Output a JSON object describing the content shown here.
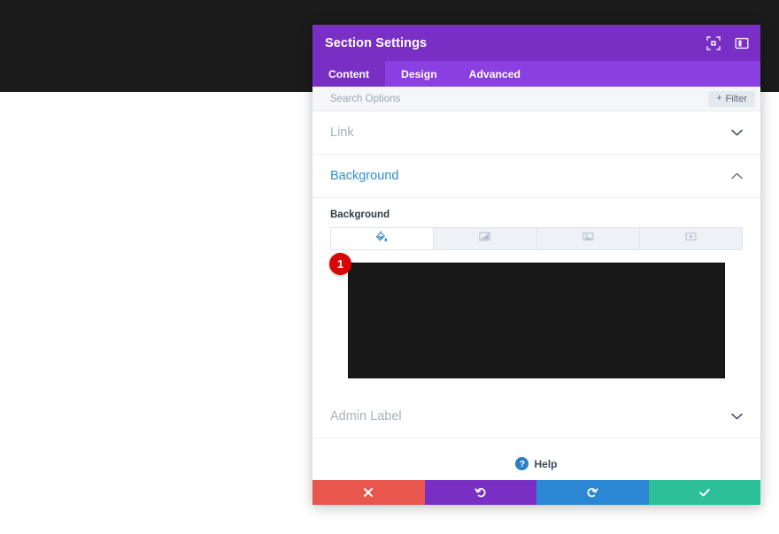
{
  "panel": {
    "title": "Section Settings",
    "header_icons": [
      {
        "name": "focus-target-icon",
        "label": "Focus"
      },
      {
        "name": "panel-layout-icon",
        "label": "Layout"
      }
    ],
    "tabs": [
      {
        "label": "Content",
        "active": true
      },
      {
        "label": "Design",
        "active": false
      },
      {
        "label": "Advanced",
        "active": false
      }
    ],
    "search": {
      "placeholder": "Search Options",
      "value": "",
      "filter_label": "Filter",
      "filter_plus": "+"
    },
    "sections": [
      {
        "label": "Link",
        "state": "collapsed",
        "chevron": "down"
      },
      {
        "label": "Background",
        "state": "expanded",
        "chevron": "up"
      },
      {
        "label": "Admin Label",
        "state": "collapsed",
        "chevron": "down"
      }
    ],
    "background": {
      "field_label": "Background",
      "types": [
        {
          "name": "background-color-tab",
          "icon": "paint-bucket-icon",
          "active": true
        },
        {
          "name": "background-gradient-tab",
          "icon": "gradient-icon",
          "active": false
        },
        {
          "name": "background-image-tab",
          "icon": "image-icon",
          "active": false
        },
        {
          "name": "background-video-tab",
          "icon": "video-icon",
          "active": false
        }
      ],
      "selected_color": "#181818",
      "step_badge": "1"
    },
    "help": {
      "glyph": "?",
      "label": "Help"
    },
    "footer": [
      {
        "name": "cancel-button",
        "icon": "close-x-icon",
        "color": "#e9564e"
      },
      {
        "name": "undo-button",
        "icon": "undo-arrow-icon",
        "color": "#7a2fc4"
      },
      {
        "name": "redo-button",
        "icon": "redo-arrow-icon",
        "color": "#2b86d4"
      },
      {
        "name": "save-button",
        "icon": "check-icon",
        "color": "#2dbf9a"
      }
    ]
  },
  "page": {
    "top_band_color": "#1b1b1b",
    "background_color": "#ffffff"
  }
}
